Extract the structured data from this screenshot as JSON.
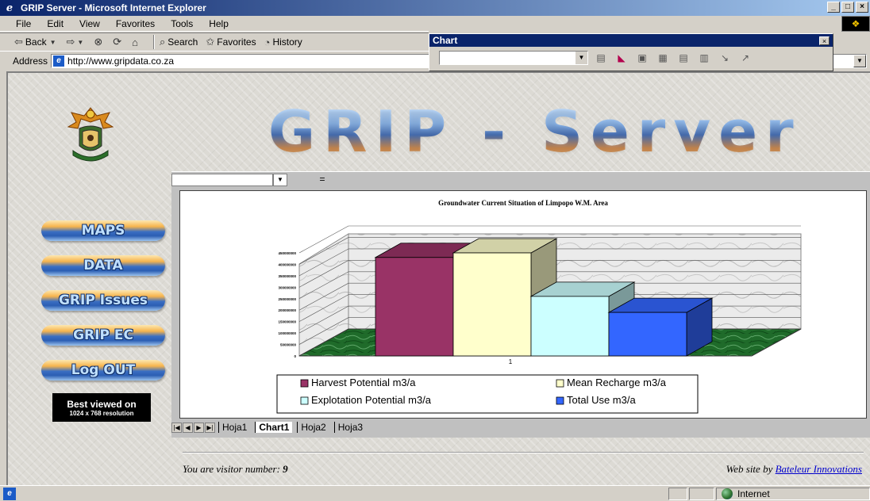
{
  "window": {
    "title": "GRIP Server - Microsoft Internet Explorer"
  },
  "menu": [
    "File",
    "Edit",
    "View",
    "Favorites",
    "Tools",
    "Help"
  ],
  "toolbar": {
    "back": "Back",
    "search": "Search",
    "favorites": "Favorites",
    "history": "History"
  },
  "address": {
    "label": "Address",
    "url": "http://www.gripdata.co.za"
  },
  "chart_toolbar": {
    "title": "Chart"
  },
  "page": {
    "banner": "GRIP - Server",
    "nav": [
      "MAPS",
      "DATA",
      "GRIP Issues",
      "GRIP EC",
      "Log OUT"
    ],
    "best_viewed": {
      "line1": "Best viewed on",
      "line2": "1024 x 768 resolution"
    },
    "formula_bar": "=",
    "sheet_tabs": [
      "Hoja1",
      "Chart1",
      "Hoja2",
      "Hoja3"
    ],
    "active_sheet": "Chart1",
    "visitor_label": "You are visitor number:",
    "visitor_count": "9",
    "credits_label": "Web site by",
    "credits_link": "Bateleur Innovations"
  },
  "status": {
    "zone": "Internet"
  },
  "chart_data": {
    "type": "bar",
    "title": "Groundwater Current Situation of Limpopo W.M. Area",
    "categories": [
      "1"
    ],
    "yticks": [
      "0",
      "50000000",
      "100000000",
      "150000000",
      "200000000",
      "250000000",
      "300000000",
      "350000000",
      "400000000",
      "450000000"
    ],
    "ylim": [
      0,
      450000000
    ],
    "series": [
      {
        "name": "Harvest Potential m3/a",
        "values": [
          430000000
        ],
        "color": "#993366"
      },
      {
        "name": "Mean Recharge   m3/a",
        "values": [
          450000000
        ],
        "color": "#ffffcc"
      },
      {
        "name": "Explotation Potential m3/a",
        "values": [
          260000000
        ],
        "color": "#ccffff"
      },
      {
        "name": "Total Use  m3/a",
        "values": [
          190000000
        ],
        "color": "#3366ff"
      }
    ],
    "legend": "bottom",
    "grid": true
  }
}
